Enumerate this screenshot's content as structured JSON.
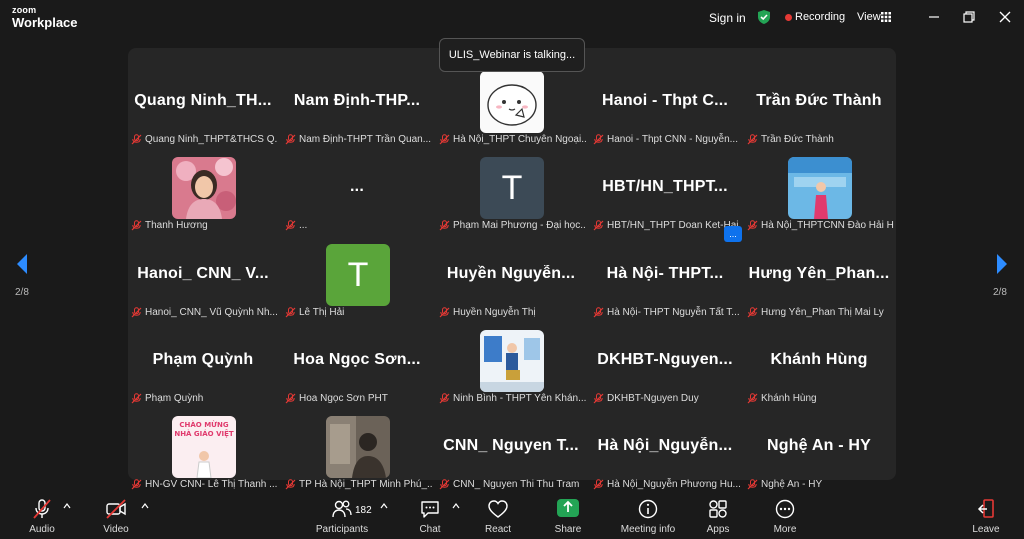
{
  "app": {
    "logo_line1": "zoom",
    "logo_line2": "Workplace"
  },
  "titlebar": {
    "signin": "Sign in",
    "recording": "Recording",
    "view": "View"
  },
  "talking_banner": "ULIS_Webinar is talking...",
  "pagination": {
    "left_label": "2/8",
    "right_label": "2/8"
  },
  "tiles": [
    {
      "name_big": "Quang  Ninh_TH...",
      "label": "Quang Ninh_THPT&THCS Q..."
    },
    {
      "name_big": "Nam  Định-THP...",
      "label": "Nam Định-THPT Trần Quan..."
    },
    {
      "avatar": "cartoon",
      "label": "Hà Nội_THPT Chuyên Ngoại..."
    },
    {
      "name_big": "Hanoi  -  Thpt  C...",
      "label": "Hanoi - Thpt CNN - Nguyễn..."
    },
    {
      "name_big": "Trần Đức Thành",
      "label": "Trần Đức Thành"
    },
    {
      "avatar": "photo-pink",
      "label": "Thanh Hương"
    },
    {
      "name_big": "...",
      "label": "..."
    },
    {
      "avatar": "letter",
      "letter": "T",
      "avatar_color": "#3c4a56",
      "label": "Phạm Mai Phương - Đại học..."
    },
    {
      "name_big": "HBT/HN_THPT...",
      "label": "HBT/HN_THPT Doan Ket-Hai..."
    },
    {
      "avatar": "photo-blue",
      "label": "Hà Nội_THPTCNN Đào Hải Hà"
    },
    {
      "name_big": "Hanoi_  CNN_  V...",
      "label": "Hanoi_ CNN_ Vũ Quỳnh Nh..."
    },
    {
      "avatar": "letter",
      "letter": "T",
      "avatar_color": "#5aa53a",
      "label": "Lê Thị Hải"
    },
    {
      "name_big": "Huyền  Nguyễn...",
      "label": "Huyền Nguyễn Thị"
    },
    {
      "name_big": "Hà  Nội-  THPT...",
      "label": "Hà Nội- THPT Nguyễn Tất T..."
    },
    {
      "name_big": "Hưng  Yên_Phan...",
      "label": "Hưng Yên_Phan Thị Mai Ly"
    },
    {
      "name_big": "Phạm Quỳnh",
      "label": "Phạm Quỳnh"
    },
    {
      "name_big": "Hoa  Ngọc  Sơn...",
      "label": "Hoa Ngọc Sơn PHT"
    },
    {
      "avatar": "photo-award",
      "label": "Ninh Bình - THPT Yên Khán..."
    },
    {
      "name_big": "DKHBT-Nguyen...",
      "label": "DKHBT-Nguyen Duy"
    },
    {
      "name_big": "Khánh Hùng",
      "label": "Khánh Hùng"
    },
    {
      "avatar": "photo-poster",
      "label": "HN-GV CNN- Lê Thị Thanh ..."
    },
    {
      "avatar": "photo-dark",
      "label": "TP Hà Nội_THPT Minh Phú_..."
    },
    {
      "name_big": "CNN_  Nguyen  T...",
      "label": "CNN_ Nguyen Thi Thu Tram"
    },
    {
      "name_big": "Hà  Nội_Nguyễn...",
      "label": "Hà Nội_Nguyễn Phương Hu..."
    },
    {
      "name_big": "Nghệ An - HY",
      "label": "Nghệ An - HY"
    }
  ],
  "more_button": "...",
  "toolbar": {
    "audio": "Audio",
    "video": "Video",
    "participants": "Participants",
    "participants_count": "182",
    "chat": "Chat",
    "react": "React",
    "share": "Share",
    "meeting_info": "Meeting info",
    "apps": "Apps",
    "more": "More",
    "leave": "Leave"
  },
  "colors": {
    "background": "#1a1a1a",
    "gallery": "#262626",
    "recording": "#e53935",
    "shield": "#23a455",
    "accent": "#0e72ed",
    "muted_red": "#e53935"
  }
}
